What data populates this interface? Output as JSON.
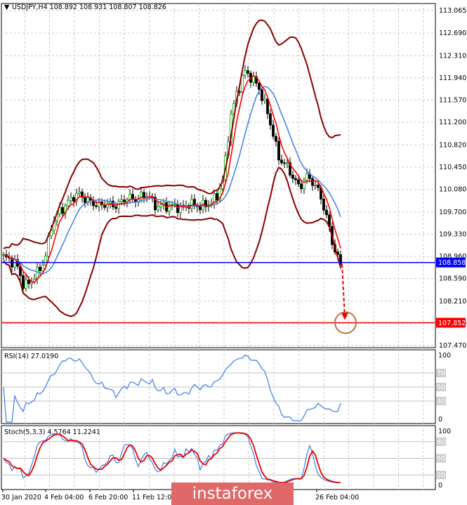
{
  "header": {
    "symbol": "USDJPY,H4",
    "ohlc": "108.892 108.931 108.807 108.826"
  },
  "watermark": "instaforex",
  "chart_data": [
    {
      "type": "candlestick",
      "title": "USDJPY,H4",
      "ylim": [
        107.47,
        113.065
      ],
      "y_ticks": [
        "113.065",
        "112.690",
        "112.310",
        "111.940",
        "111.570",
        "111.200",
        "110.820",
        "110.450",
        "110.080",
        "109.700",
        "109.330",
        "108.960",
        "108.590",
        "108.210",
        "107.840",
        "107.470"
      ],
      "levels": [
        {
          "value": 108.858,
          "label": "108.858",
          "color": "#0000ff"
        },
        {
          "value": 107.852,
          "label": "107.852",
          "color": "#ff0000"
        }
      ],
      "x_labels": [
        "30 Jan 2020",
        "4 Feb 04:00",
        "6 Feb 20:00",
        "11 Feb 12:00",
        "26 Feb 04:00"
      ],
      "close_path": [
        108.95,
        108.9,
        108.8,
        108.45,
        108.55,
        108.7,
        108.9,
        109.5,
        109.7,
        109.8,
        109.95,
        110.0,
        109.9,
        109.85,
        109.8,
        109.85,
        109.8,
        109.85,
        109.95,
        109.9,
        109.95,
        110.0,
        109.8,
        109.8,
        109.8,
        109.8,
        109.75,
        109.85,
        109.8,
        109.8,
        109.85,
        109.95,
        110.3,
        111.3,
        111.7,
        112.05,
        111.95,
        111.8,
        111.5,
        111.1,
        110.6,
        110.5,
        110.3,
        110.1,
        110.3,
        110.2,
        110.0,
        109.6,
        109.1,
        108.83
      ],
      "colors": {
        "bull": "#00aa00",
        "bear": "#000000",
        "bands": "#8b0000",
        "fast_ma": "#ff0000",
        "slow_ma": "#4a86e8"
      },
      "forecast": {
        "target": 107.852
      }
    },
    {
      "type": "line",
      "title": "RSI(14) 27.0190",
      "ylim": [
        0,
        100
      ],
      "levels": [
        "70",
        "50",
        "30"
      ],
      "top_label": "100",
      "bottom_label": "0"
    },
    {
      "type": "line",
      "title": "Stoch(5,3,3) 4.5764 11.2241",
      "ylim": [
        0,
        100
      ],
      "levels": [
        "80",
        "50",
        "20"
      ],
      "top_label": "100",
      "bottom_label": "0"
    }
  ]
}
